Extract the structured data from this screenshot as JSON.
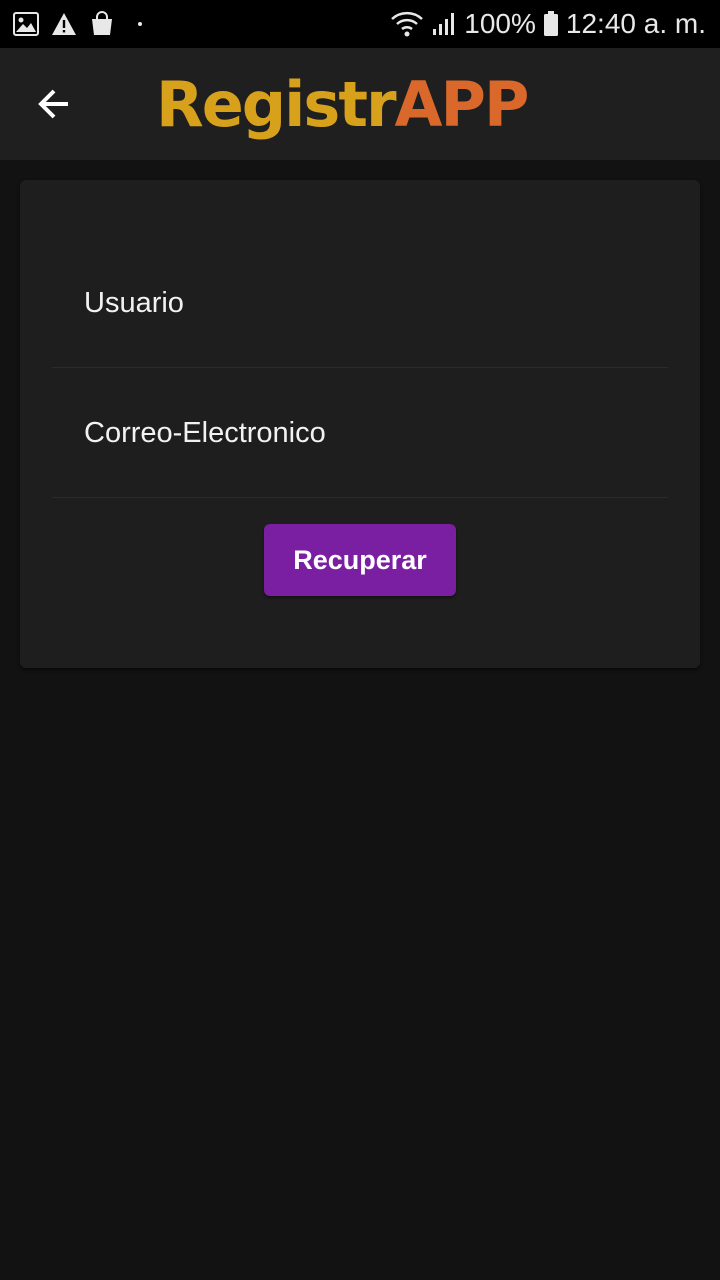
{
  "status_bar": {
    "battery": "100%",
    "time": "12:40 a. m.",
    "left_icons": [
      "image-icon",
      "warning-icon",
      "shopping-bag-icon",
      "dot-icon"
    ],
    "right_icons": [
      "wifi-icon",
      "signal-icon",
      "battery-icon"
    ]
  },
  "toolbar": {
    "back_icon": "arrow-left-icon",
    "logo_part1": "Registr",
    "logo_part2": "APP",
    "colors": {
      "logo_part1": "#d7a11c",
      "logo_part2": "#d9682a"
    }
  },
  "form": {
    "username_label": "Usuario",
    "email_label": "Correo-Electronico",
    "submit_label": "Recuperar"
  },
  "colors": {
    "background": "#121212",
    "card": "#1e1e1e",
    "toolbar": "#1f1f1f",
    "button": "#7b1fa2"
  }
}
